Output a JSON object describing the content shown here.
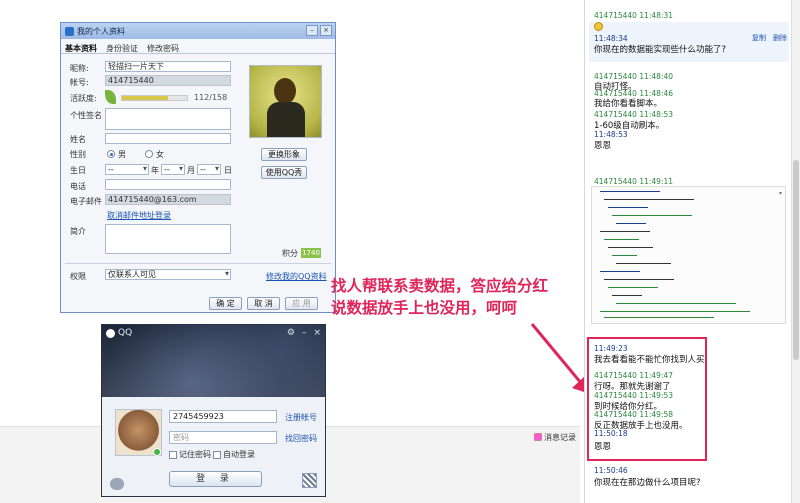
{
  "background": {
    "message_record_label": "消息记录"
  },
  "profile": {
    "title": "我的个人资料",
    "tabs": [
      "基本资料",
      "身份验证",
      "修改密码"
    ],
    "nickname_label": "昵称:",
    "nickname_value": "轻描扫一片天下",
    "account_label": "帐号:",
    "account_value": "414715440",
    "activity_label": "活跃度:",
    "activity_value": "112/158",
    "activity_fraction": 0.709,
    "signature_label": "个性签名",
    "name_label": "姓名",
    "gender_label": "性别",
    "gender_options": [
      "男",
      "女"
    ],
    "gender_selected": "男",
    "birthday_label": "生日",
    "birthday_units": [
      "年",
      "月",
      "日"
    ],
    "birthday_placeholder": "--",
    "phone_label": "电话",
    "email_label": "电子邮件",
    "email_value": "414715440@163.com",
    "email_link": "取消邮件地址登录",
    "intro_label": "简介",
    "score_label": "积分",
    "score_value": "1740",
    "change_avatar_button": "更换形象",
    "use_show_button": "使用QQ秀",
    "permission_label": "权限",
    "permission_value": "仅联系人可见",
    "edit_link": "修改我的QQ资料",
    "ok_button": "确 定",
    "cancel_button": "取 消",
    "apply_button": "应 用"
  },
  "login": {
    "title": "QQ",
    "account_value": "2745459923",
    "password_placeholder": "密码",
    "register_link": "注册帐号",
    "forgot_link": "找回密码",
    "remember_label": "记住密码",
    "autologin_label": "自动登录",
    "login_button": "登 录"
  },
  "annotation": {
    "line1": "找人帮联系卖数据，答应给分红",
    "line2": "说数据放手上也没用，呵呵"
  },
  "chat": {
    "copy_label": "复制",
    "delete_label": "删除",
    "lines": [
      {
        "kind": "hdr-g",
        "text": "414715440  11:48:31"
      },
      {
        "kind": "hdr-b",
        "text": "       11:48:34"
      },
      {
        "kind": "txt",
        "text": "你现在的数据能实现些什么功能了?"
      },
      {
        "kind": "hdr-g",
        "text": "414715440  11:48:40"
      },
      {
        "kind": "txt",
        "text": "自动打怪。"
      },
      {
        "kind": "hdr-g",
        "text": "414715440  11:48:46"
      },
      {
        "kind": "txt",
        "text": "我给你看看脚本。"
      },
      {
        "kind": "hdr-g",
        "text": "414715440  11:48:53"
      },
      {
        "kind": "txt",
        "text": "1-60级自动刷本。"
      },
      {
        "kind": "hdr-b",
        "text": "       11:48:53"
      },
      {
        "kind": "txt",
        "text": "恩恩"
      },
      {
        "kind": "hdr-g",
        "text": "414715440  11:49:11"
      },
      {
        "kind": "hdr-b",
        "text": "       11:49:23"
      },
      {
        "kind": "txt",
        "text": "我去看看能不能忙你找到人买"
      },
      {
        "kind": "hdr-g",
        "text": "414715440  11:49:47"
      },
      {
        "kind": "txt",
        "text": "  行呀。那就先谢谢了"
      },
      {
        "kind": "hdr-g",
        "text": "414715440  11:49:53"
      },
      {
        "kind": "txt",
        "text": "到时候给你分红。"
      },
      {
        "kind": "hdr-g",
        "text": "414715440  11:49:58"
      },
      {
        "kind": "txt",
        "text": "反正数据放手上也没用。"
      },
      {
        "kind": "hdr-b",
        "text": "       11:50:18"
      },
      {
        "kind": "txt",
        "text": "恩恩"
      },
      {
        "kind": "hdr-b",
        "text": "       11:50:46"
      },
      {
        "kind": "txt",
        "text": "你现在在那边做什么项目呢?"
      }
    ]
  },
  "colors": {
    "annotation": "#e0255b",
    "chat_header_green": "#2a8a3c",
    "chat_header_blue": "#1a3d8f"
  }
}
